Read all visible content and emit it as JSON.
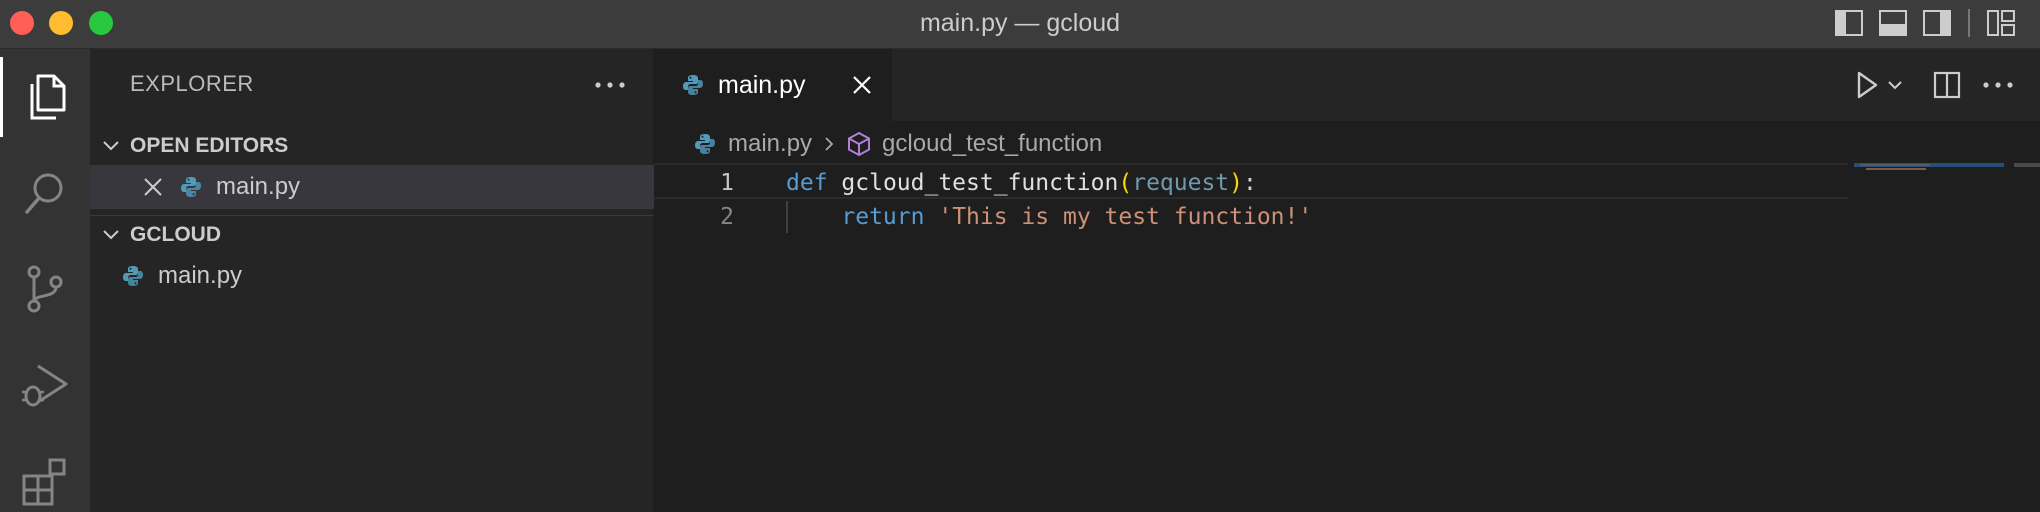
{
  "window": {
    "title": "main.py — gcloud"
  },
  "sidebar": {
    "header": "EXPLORER",
    "open_editors": {
      "title": "OPEN EDITORS",
      "files": [
        {
          "name": "main.py"
        }
      ]
    },
    "folder": {
      "title": "GCLOUD",
      "files": [
        {
          "name": "main.py"
        }
      ]
    }
  },
  "editor": {
    "tab": {
      "label": "main.py"
    },
    "breadcrumb": {
      "file": "main.py",
      "symbol": "gcloud_test_function"
    },
    "lines": [
      {
        "number": "1",
        "kw": "def",
        "name": "gcloud_test_function",
        "open": "(",
        "param": "request",
        "close": ")",
        "colon": ":"
      },
      {
        "number": "2",
        "kw": "return",
        "string": "'This is my test function!'"
      }
    ]
  },
  "colors": {
    "traffic_close": "#ff5f57",
    "traffic_min": "#febc2e",
    "traffic_max": "#28c840",
    "python_blue": "#519aba",
    "keyword": "#569cd6",
    "string": "#ce9178",
    "bracket": "#ffd700",
    "symbol_purple": "#b180d7"
  }
}
